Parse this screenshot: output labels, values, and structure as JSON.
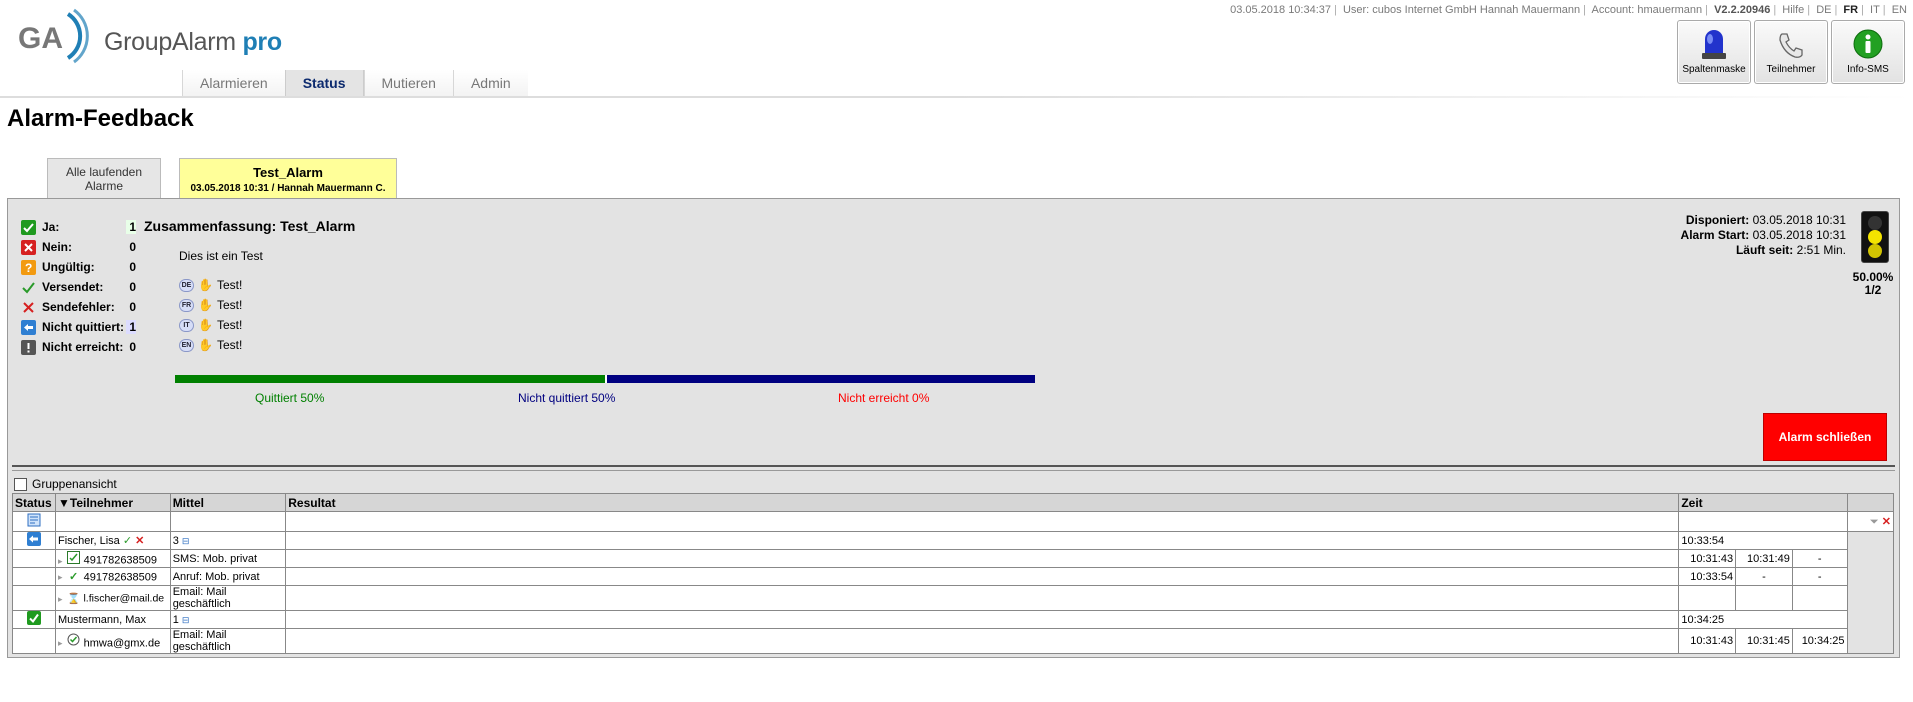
{
  "app": {
    "logo_name": "GroupAlarm",
    "logo_suffix": "pro",
    "logo_mark": "GA"
  },
  "topbar": {
    "datetime": "03.05.2018 10:34:37",
    "user": "User: cubos Internet GmbH Hannah Mauermann",
    "account": "Account: hmauermann",
    "version": "V2.2.20946",
    "help": "Hilfe",
    "languages": [
      "DE",
      "FR",
      "IT",
      "EN"
    ],
    "current_language": "FR"
  },
  "nav": {
    "tabs": [
      "Alarmieren",
      "Status",
      "Mutieren",
      "Admin"
    ],
    "active": "Status"
  },
  "toolbar": {
    "buttons": [
      {
        "label": "Spaltenmaske",
        "icon": "siren-icon"
      },
      {
        "label": "Teilnehmer",
        "icon": "phone-icon"
      },
      {
        "label": "Info-SMS",
        "icon": "info-icon"
      }
    ]
  },
  "page": {
    "title": "Alarm-Feedback"
  },
  "subtabs": {
    "all_line1": "Alle laufenden",
    "all_line2": "Alarme",
    "current_title": "Test_Alarm",
    "current_sub": "03.05.2018 10:31 / Hannah Mauermann C."
  },
  "counts": [
    {
      "label": "Ja:",
      "value": "1",
      "icon": "check-green-icon"
    },
    {
      "label": "Nein:",
      "value": "0",
      "icon": "x-red-icon"
    },
    {
      "label": "Ungültig:",
      "value": "0",
      "icon": "question-orange-icon"
    },
    {
      "label": "Versendet:",
      "value": "0",
      "icon": "checkmark-icon"
    },
    {
      "label": "Sendefehler:",
      "value": "0",
      "icon": "x-icon"
    },
    {
      "label": "Nicht quittiert:",
      "value": "1",
      "icon": "arrow-back-icon"
    },
    {
      "label": "Nicht erreicht:",
      "value": "0",
      "icon": "exclamation-icon"
    }
  ],
  "summary": {
    "title": "Zusammenfassung: Test_Alarm",
    "text": "Dies ist ein Test",
    "languages": [
      {
        "code": "DE",
        "text": "Test!"
      },
      {
        "code": "FR",
        "text": "Test!"
      },
      {
        "code": "IT",
        "text": "Test!"
      },
      {
        "code": "EN",
        "text": "Test!"
      }
    ]
  },
  "progress": {
    "segments": [
      {
        "label": "Quittiert 50%",
        "fraction": 0.5,
        "color": "#008000"
      },
      {
        "label": "Nicht quittiert 50%",
        "fraction": 0.5,
        "color": "#000080"
      },
      {
        "label": "Nicht erreicht 0%",
        "fraction": 0.0,
        "color": "#ff0000"
      }
    ]
  },
  "times": {
    "disponiert_label": "Disponiert:",
    "disponiert": "03.05.2018 10:31",
    "start_label": "Alarm Start:",
    "start": "03.05.2018 10:31",
    "running_label": "Läuft seit:",
    "running": "2:51 Min."
  },
  "rate": {
    "percent": "50.00%",
    "ratio": "1/2"
  },
  "close_button": "Alarm schließen",
  "group_view": "Gruppenansicht",
  "table": {
    "headers": [
      "Status",
      "▼Teilnehmer",
      "Mittel",
      "Resultat",
      "Zeit"
    ],
    "rows": [
      {
        "kind": "person",
        "status_icon": "arrow-back-icon",
        "name": "Fischer, Lisa",
        "mittel": "3",
        "resultat": "",
        "times": [
          "10:33:54"
        ]
      },
      {
        "kind": "channel",
        "status_icon": "sms-icon",
        "name": "491782638509",
        "mittel": "SMS: Mob. privat",
        "resultat": "",
        "times": [
          "10:31:43",
          "10:31:49",
          "-"
        ]
      },
      {
        "kind": "channel",
        "status_icon": "checkmark-icon",
        "name": "491782638509",
        "mittel": "Anruf: Mob. privat",
        "resultat": "",
        "times": [
          "10:33:54",
          "-",
          "-"
        ]
      },
      {
        "kind": "channel",
        "status_icon": "hourglass-icon",
        "name": "l.fischer@mail.de",
        "mittel": "Email: Mail geschäftlich",
        "resultat": "",
        "times": [
          "",
          "",
          ""
        ]
      },
      {
        "kind": "person",
        "status_icon": "check-green-icon",
        "name": "Mustermann, Max",
        "mittel": "1",
        "resultat": "",
        "times": [
          "10:34:25"
        ]
      },
      {
        "kind": "channel",
        "status_icon": "circle-check-icon",
        "name": "hmwa@gmx.de",
        "mittel": "Email: Mail geschäftlich",
        "resultat": "",
        "times": [
          "10:31:43",
          "10:31:45",
          "10:34:25"
        ]
      }
    ]
  },
  "colors": {
    "accent": "#0c2a6e",
    "panel": "#e3e3e3",
    "active_tab": "#ffff99",
    "close": "#ff0000"
  }
}
